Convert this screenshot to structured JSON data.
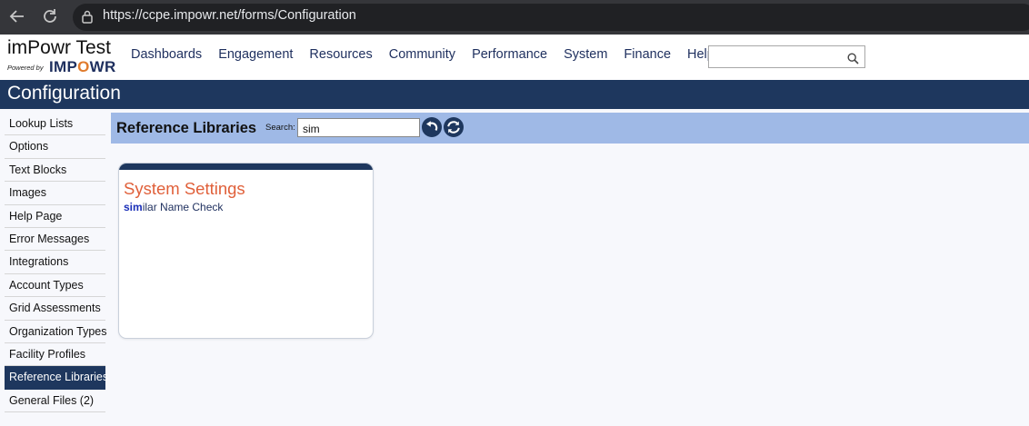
{
  "browser": {
    "url": "https://ccpe.impowr.net/forms/Configuration"
  },
  "logo": {
    "title": "imPowr Test",
    "powered_by": "Powered by",
    "brand_pre": "IMP",
    "brand_o": "O",
    "brand_post": "WR"
  },
  "topnav": [
    "Dashboards",
    "Engagement",
    "Resources",
    "Community",
    "Performance",
    "System",
    "Finance",
    "Help"
  ],
  "header_search": {
    "value": "",
    "placeholder": ""
  },
  "page_title": "Configuration",
  "sidebar": {
    "items": [
      {
        "label": "Lookup Lists",
        "active": false
      },
      {
        "label": "Options",
        "active": false
      },
      {
        "label": "Text Blocks",
        "active": false
      },
      {
        "label": "Images",
        "active": false
      },
      {
        "label": "Help Page",
        "active": false
      },
      {
        "label": "Error Messages",
        "active": false
      },
      {
        "label": "Integrations",
        "active": false
      },
      {
        "label": "Account Types",
        "active": false
      },
      {
        "label": "Grid Assessments",
        "active": false
      },
      {
        "label": "Organization Types",
        "active": false
      },
      {
        "label": "Facility Profiles",
        "active": false
      },
      {
        "label": "Reference Libraries",
        "active": true
      },
      {
        "label": "General Files (2)",
        "active": false
      }
    ]
  },
  "section": {
    "title": "Reference Libraries",
    "search_label": "Search:",
    "search_value": "sim"
  },
  "results": {
    "group_title": "System Settings",
    "item_match": "sim",
    "item_rest": "ilar Name Check"
  },
  "colors": {
    "navy": "#1e375e",
    "section_band": "#9fb9e6",
    "card_title": "#e0603a",
    "match_highlight": "#1a2fb8",
    "logo_accent": "#e07b2c"
  },
  "icons": {
    "back": "arrow-left-icon",
    "reload": "reload-icon",
    "lock": "lock-icon",
    "search": "magnifier-icon",
    "undo": "undo-icon",
    "refresh": "refresh-icon"
  }
}
